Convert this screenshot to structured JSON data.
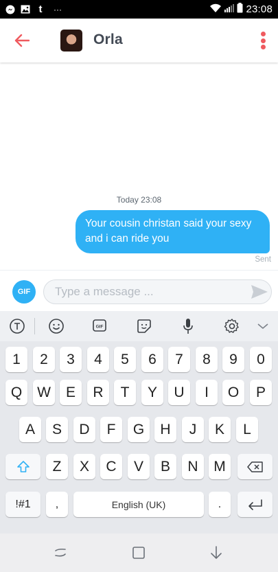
{
  "status_bar": {
    "time": "23:08",
    "left_icons": [
      "messenger-icon",
      "image-icon",
      "tumblr-icon",
      "more-icon"
    ],
    "tumblr_glyph": "t",
    "more_glyph": "···"
  },
  "header": {
    "contact_name": "Orla",
    "accent_color": "#ef5a5f"
  },
  "chat": {
    "timestamp": "Today 23:08",
    "messages": [
      {
        "text": "Your cousin christan said your sexy and i can ride you",
        "status": "Sent",
        "direction": "outgoing",
        "bubble_color": "#2fb1f5"
      }
    ]
  },
  "composer": {
    "gif_label": "GIF",
    "placeholder": "Type a message ...",
    "value": ""
  },
  "keyboard": {
    "toolbar_icons": [
      "text-cursor-icon",
      "emoji-icon",
      "gif-icon",
      "sticker-icon",
      "microphone-icon",
      "settings-icon",
      "chevron-down-icon"
    ],
    "row1": [
      "1",
      "2",
      "3",
      "4",
      "5",
      "6",
      "7",
      "8",
      "9",
      "0"
    ],
    "row2": [
      "Q",
      "W",
      "E",
      "R",
      "T",
      "Y",
      "U",
      "I",
      "O",
      "P"
    ],
    "row3": [
      "A",
      "S",
      "D",
      "F",
      "G",
      "H",
      "J",
      "K",
      "L"
    ],
    "row4": [
      "Z",
      "X",
      "C",
      "V",
      "B",
      "N",
      "M"
    ],
    "symbols_label": "!#1",
    "comma": ",",
    "space_label": "English (UK)",
    "period": "."
  },
  "navbar": {
    "buttons": [
      "recent-apps-icon",
      "home-icon",
      "back-nav-icon"
    ]
  }
}
